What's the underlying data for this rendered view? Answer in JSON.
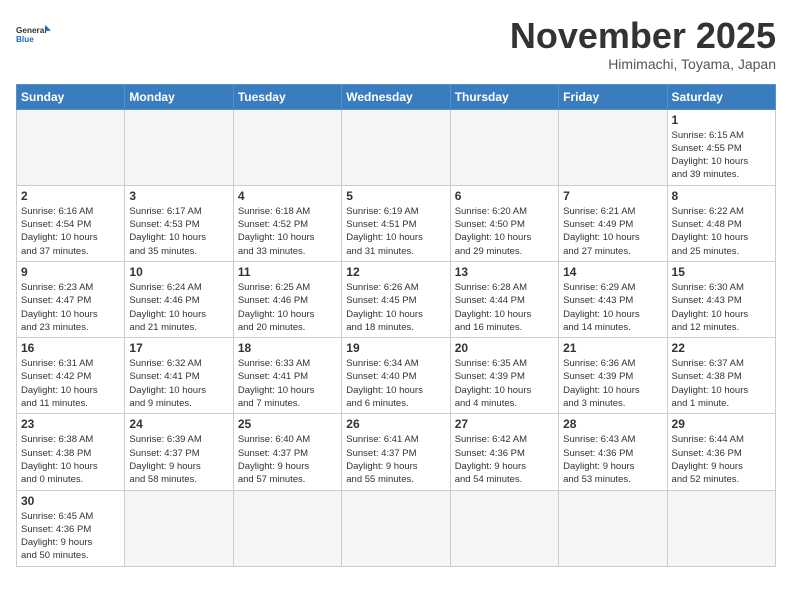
{
  "logo": {
    "line1": "General",
    "line2": "Blue"
  },
  "title": "November 2025",
  "subtitle": "Himimachi, Toyama, Japan",
  "days_of_week": [
    "Sunday",
    "Monday",
    "Tuesday",
    "Wednesday",
    "Thursday",
    "Friday",
    "Saturday"
  ],
  "weeks": [
    [
      {
        "day": "",
        "info": "",
        "empty": true
      },
      {
        "day": "",
        "info": "",
        "empty": true
      },
      {
        "day": "",
        "info": "",
        "empty": true
      },
      {
        "day": "",
        "info": "",
        "empty": true
      },
      {
        "day": "",
        "info": "",
        "empty": true
      },
      {
        "day": "",
        "info": "",
        "empty": true
      },
      {
        "day": "1",
        "info": "Sunrise: 6:15 AM\nSunset: 4:55 PM\nDaylight: 10 hours\nand 39 minutes."
      }
    ],
    [
      {
        "day": "2",
        "info": "Sunrise: 6:16 AM\nSunset: 4:54 PM\nDaylight: 10 hours\nand 37 minutes."
      },
      {
        "day": "3",
        "info": "Sunrise: 6:17 AM\nSunset: 4:53 PM\nDaylight: 10 hours\nand 35 minutes."
      },
      {
        "day": "4",
        "info": "Sunrise: 6:18 AM\nSunset: 4:52 PM\nDaylight: 10 hours\nand 33 minutes."
      },
      {
        "day": "5",
        "info": "Sunrise: 6:19 AM\nSunset: 4:51 PM\nDaylight: 10 hours\nand 31 minutes."
      },
      {
        "day": "6",
        "info": "Sunrise: 6:20 AM\nSunset: 4:50 PM\nDaylight: 10 hours\nand 29 minutes."
      },
      {
        "day": "7",
        "info": "Sunrise: 6:21 AM\nSunset: 4:49 PM\nDaylight: 10 hours\nand 27 minutes."
      },
      {
        "day": "8",
        "info": "Sunrise: 6:22 AM\nSunset: 4:48 PM\nDaylight: 10 hours\nand 25 minutes."
      }
    ],
    [
      {
        "day": "9",
        "info": "Sunrise: 6:23 AM\nSunset: 4:47 PM\nDaylight: 10 hours\nand 23 minutes."
      },
      {
        "day": "10",
        "info": "Sunrise: 6:24 AM\nSunset: 4:46 PM\nDaylight: 10 hours\nand 21 minutes."
      },
      {
        "day": "11",
        "info": "Sunrise: 6:25 AM\nSunset: 4:46 PM\nDaylight: 10 hours\nand 20 minutes."
      },
      {
        "day": "12",
        "info": "Sunrise: 6:26 AM\nSunset: 4:45 PM\nDaylight: 10 hours\nand 18 minutes."
      },
      {
        "day": "13",
        "info": "Sunrise: 6:28 AM\nSunset: 4:44 PM\nDaylight: 10 hours\nand 16 minutes."
      },
      {
        "day": "14",
        "info": "Sunrise: 6:29 AM\nSunset: 4:43 PM\nDaylight: 10 hours\nand 14 minutes."
      },
      {
        "day": "15",
        "info": "Sunrise: 6:30 AM\nSunset: 4:43 PM\nDaylight: 10 hours\nand 12 minutes."
      }
    ],
    [
      {
        "day": "16",
        "info": "Sunrise: 6:31 AM\nSunset: 4:42 PM\nDaylight: 10 hours\nand 11 minutes."
      },
      {
        "day": "17",
        "info": "Sunrise: 6:32 AM\nSunset: 4:41 PM\nDaylight: 10 hours\nand 9 minutes."
      },
      {
        "day": "18",
        "info": "Sunrise: 6:33 AM\nSunset: 4:41 PM\nDaylight: 10 hours\nand 7 minutes."
      },
      {
        "day": "19",
        "info": "Sunrise: 6:34 AM\nSunset: 4:40 PM\nDaylight: 10 hours\nand 6 minutes."
      },
      {
        "day": "20",
        "info": "Sunrise: 6:35 AM\nSunset: 4:39 PM\nDaylight: 10 hours\nand 4 minutes."
      },
      {
        "day": "21",
        "info": "Sunrise: 6:36 AM\nSunset: 4:39 PM\nDaylight: 10 hours\nand 3 minutes."
      },
      {
        "day": "22",
        "info": "Sunrise: 6:37 AM\nSunset: 4:38 PM\nDaylight: 10 hours\nand 1 minute."
      }
    ],
    [
      {
        "day": "23",
        "info": "Sunrise: 6:38 AM\nSunset: 4:38 PM\nDaylight: 10 hours\nand 0 minutes."
      },
      {
        "day": "24",
        "info": "Sunrise: 6:39 AM\nSunset: 4:37 PM\nDaylight: 9 hours\nand 58 minutes."
      },
      {
        "day": "25",
        "info": "Sunrise: 6:40 AM\nSunset: 4:37 PM\nDaylight: 9 hours\nand 57 minutes."
      },
      {
        "day": "26",
        "info": "Sunrise: 6:41 AM\nSunset: 4:37 PM\nDaylight: 9 hours\nand 55 minutes."
      },
      {
        "day": "27",
        "info": "Sunrise: 6:42 AM\nSunset: 4:36 PM\nDaylight: 9 hours\nand 54 minutes."
      },
      {
        "day": "28",
        "info": "Sunrise: 6:43 AM\nSunset: 4:36 PM\nDaylight: 9 hours\nand 53 minutes."
      },
      {
        "day": "29",
        "info": "Sunrise: 6:44 AM\nSunset: 4:36 PM\nDaylight: 9 hours\nand 52 minutes."
      }
    ],
    [
      {
        "day": "30",
        "info": "Sunrise: 6:45 AM\nSunset: 4:36 PM\nDaylight: 9 hours\nand 50 minutes."
      },
      {
        "day": "",
        "info": "",
        "empty": true
      },
      {
        "day": "",
        "info": "",
        "empty": true
      },
      {
        "day": "",
        "info": "",
        "empty": true
      },
      {
        "day": "",
        "info": "",
        "empty": true
      },
      {
        "day": "",
        "info": "",
        "empty": true
      },
      {
        "day": "",
        "info": "",
        "empty": true
      }
    ]
  ]
}
